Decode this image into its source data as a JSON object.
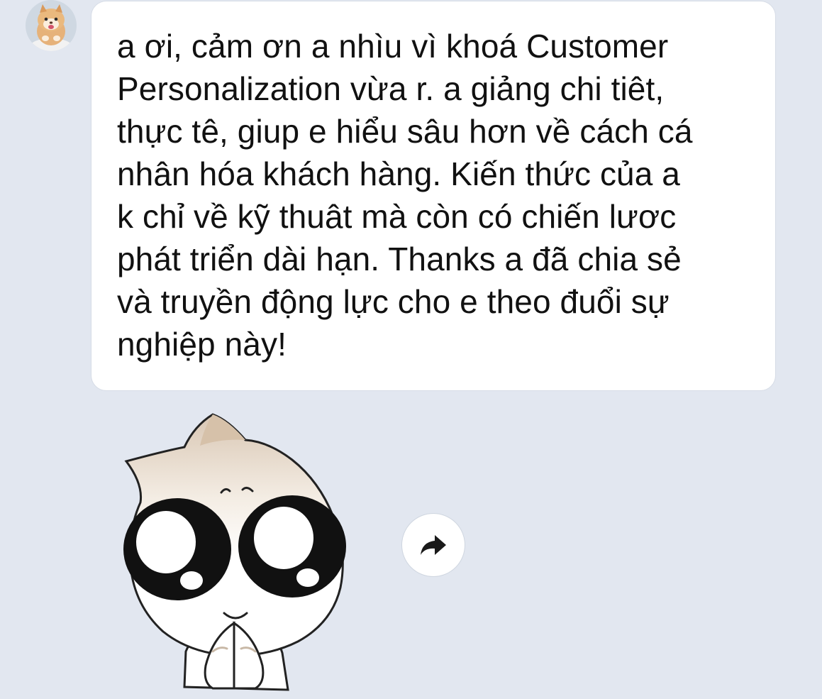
{
  "message": {
    "text": "a ơi, cảm ơn a nhìu vì khoá Customer\nPersonalization vừa r. a giảng chi tiêt,\nthực tê, giup e hiểu sâu hơn về cách cá\nnhân hóa khách hàng. Kiến thức của a\nk chỉ về kỹ thuât mà còn có chiến lươc\nphát triển dài hạn. Thanks a đã chia sẻ\nvà truyền động lực cho e theo đuổi sự\nnghiệp này!"
  },
  "sender": {
    "avatar_icon": "cat-avatar"
  },
  "sticker": {
    "icon": "pleading-bun-character-sticker"
  },
  "actions": {
    "share_icon": "share-arrow-icon"
  },
  "colors": {
    "background": "#e2e7f0",
    "bubble": "#ffffff",
    "text": "#111111"
  }
}
